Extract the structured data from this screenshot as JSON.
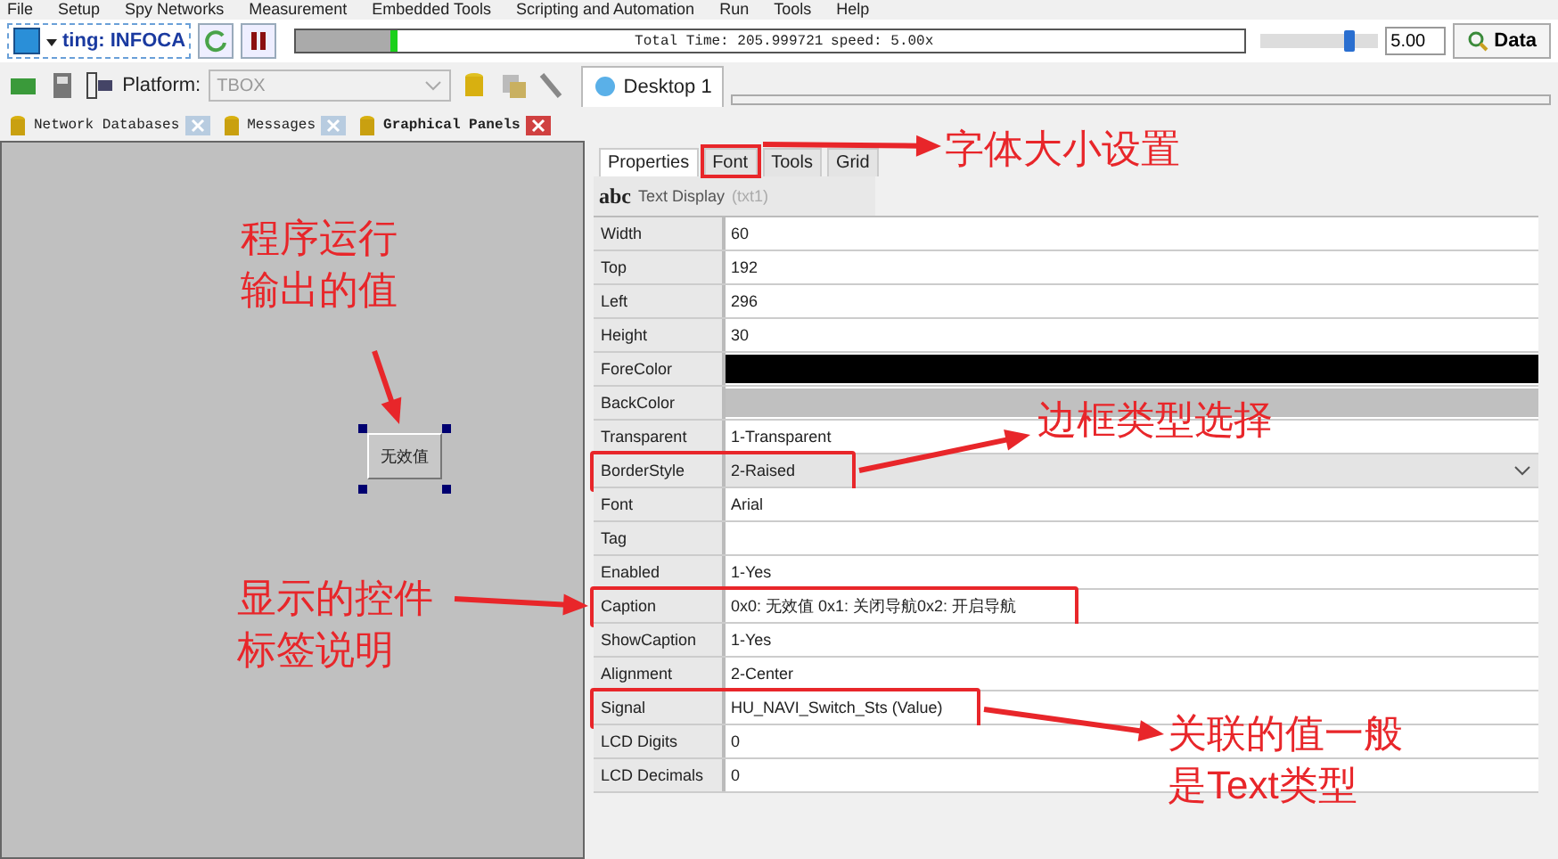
{
  "menu": [
    "File",
    "Setup",
    "Spy Networks",
    "Measurement",
    "Embedded Tools",
    "Scripting and Automation",
    "Run",
    "Tools",
    "Help"
  ],
  "toolbar": {
    "config_name": "ting: INFOCA",
    "timeline": {
      "level": 0.1,
      "total_time": "Total Time: 205.999721",
      "speed": "speed: 5.00x"
    },
    "speed_slider": {
      "level": 0.75
    },
    "speed_value": "5.00",
    "data_button": "Data"
  },
  "platform": {
    "label": "Platform:",
    "value": "TBOX",
    "disabled": true
  },
  "desktop_tab": {
    "label": "Desktop 1",
    "selected": true
  },
  "panel_tabs": [
    {
      "label": "Network Databases",
      "selected": false
    },
    {
      "label": "Messages",
      "selected": false
    },
    {
      "label": "Graphical Panels",
      "selected": true
    }
  ],
  "canvas": {
    "control": {
      "caption": "无效值",
      "selected": true
    }
  },
  "properties": {
    "tabs": [
      {
        "label": "Properties",
        "selected": true
      },
      {
        "label": "Font",
        "selected": false
      },
      {
        "label": "Tools",
        "selected": false
      },
      {
        "label": "Grid",
        "selected": false
      }
    ],
    "object_icon": "abc",
    "object_name": "Text Display",
    "object_id": "(txt1)",
    "rows": [
      {
        "name": "Width",
        "kind": "text",
        "value": "60"
      },
      {
        "name": "Top",
        "kind": "text",
        "value": "192"
      },
      {
        "name": "Left",
        "kind": "text",
        "value": "296"
      },
      {
        "name": "Height",
        "kind": "text",
        "value": "30"
      },
      {
        "name": "ForeColor",
        "kind": "color",
        "color": "#000000"
      },
      {
        "name": "BackColor",
        "kind": "color",
        "color": "#c0c0c0"
      },
      {
        "name": "Transparent",
        "kind": "text",
        "value": "1-Transparent"
      },
      {
        "name": "BorderStyle",
        "kind": "dropdown",
        "value": "2-Raised"
      },
      {
        "name": "Font",
        "kind": "text",
        "value": "Arial"
      },
      {
        "name": "Tag",
        "kind": "text"
      },
      {
        "name": "Enabled",
        "kind": "text",
        "value": "1-Yes"
      },
      {
        "name": "Caption",
        "kind": "text",
        "value": "0x0: 无效值 0x1: 关闭导航0x2: 开启导航"
      },
      {
        "name": "ShowCaption",
        "kind": "text",
        "value": "1-Yes"
      },
      {
        "name": "Alignment",
        "kind": "text",
        "value": "2-Center"
      },
      {
        "name": "Signal",
        "kind": "text",
        "value": "HU_NAVI_Switch_Sts (Value)"
      },
      {
        "name": "LCD Digits",
        "kind": "text",
        "value": "0"
      },
      {
        "name": "LCD Decimals",
        "kind": "text",
        "value": "0"
      }
    ]
  },
  "annotations": [
    {
      "text": "字体大小设置"
    },
    {
      "text": "程序运行输出的值"
    },
    {
      "text": "边框类型选择"
    },
    {
      "text": "显示的控件标签说明"
    },
    {
      "text": "关联的值一般是Text类型"
    }
  ]
}
